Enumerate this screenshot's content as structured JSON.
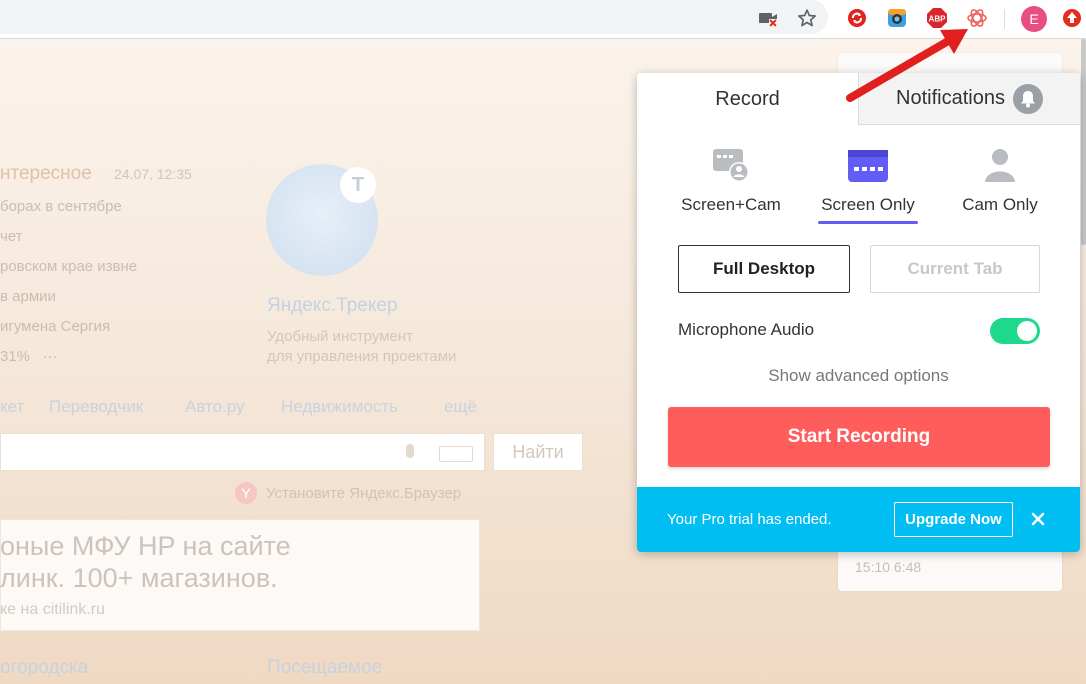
{
  "browser": {
    "avatar_letter": "E",
    "extensions": [
      "camera-blocked-icon",
      "star-icon",
      "red-arrows-extension-icon",
      "camera-extension-icon",
      "adblock-plus-icon",
      "loom-extension-icon",
      "red-upload-extension-icon"
    ],
    "abp_label": "ABP"
  },
  "background_page": {
    "news_heading": "нтересное",
    "news_date": "24.07, 12:35",
    "news_items": [
      "борах в сентябре",
      "чет",
      "ровском крае извне",
      "в армии",
      "игумена Сергия"
    ],
    "news_footer": "31%",
    "tracker_badge": "T",
    "tracker_title": "Яндекс.Трекер",
    "tracker_desc_1": "Удобный инструмент",
    "tracker_desc_2": "для управления проектами",
    "nav_links": [
      "кет",
      "Переводчик",
      "Авто.ру",
      "Недвижимость",
      "ещё"
    ],
    "search_button": "Найти",
    "ya_letter": "Y",
    "browser_promo": "Установите Яндекс.Браузер",
    "ad_line_1": "оные МФУ HP на сайте",
    "ad_line_2": "линк. 100+ магазинов.",
    "ad_line_3": "ке на citilink.ru",
    "bottom_left": "огородска",
    "bottom_mid": "Посещаемое",
    "right_time": "15:10   6:48"
  },
  "popup": {
    "tabs": {
      "record": "Record",
      "notifications": "Notifications"
    },
    "modes": [
      {
        "label": "Screen+Cam",
        "icon": "screen-cam-icon"
      },
      {
        "label": "Screen Only",
        "icon": "screen-only-icon",
        "selected": true
      },
      {
        "label": "Cam Only",
        "icon": "cam-only-icon"
      }
    ],
    "capture": {
      "full_desktop": "Full Desktop",
      "current_tab": "Current Tab"
    },
    "microphone_label": "Microphone Audio",
    "microphone_on": true,
    "advanced_link": "Show advanced options",
    "start_button": "Start Recording",
    "trial": {
      "message": "Your Pro trial has ended.",
      "upgrade": "Upgrade Now"
    }
  },
  "colors": {
    "accent_purple": "#625df5",
    "start_red": "#ff5c5c",
    "toggle_green": "#1ed98c",
    "trial_blue": "#00bdf2"
  }
}
